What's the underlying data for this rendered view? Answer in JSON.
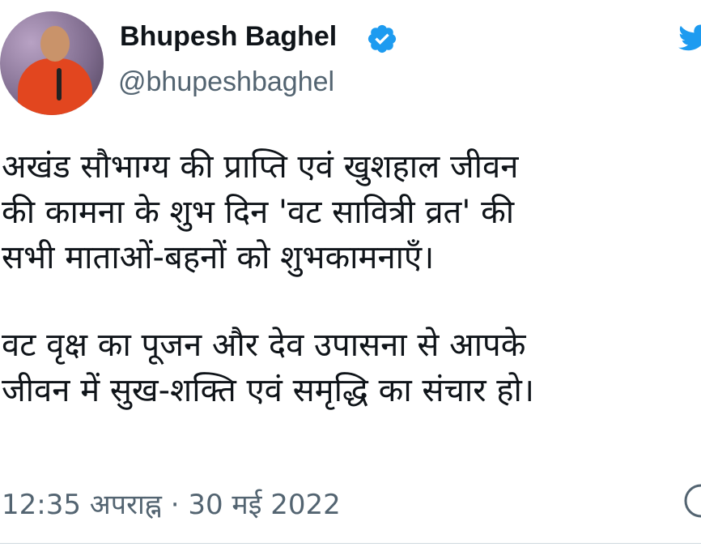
{
  "author": {
    "name": "Bhupesh Baghel",
    "handle": "@bhupeshbaghel",
    "verified": true,
    "verified_icon": "verified-badge-icon",
    "avatar": "avatar-photo"
  },
  "tweet": {
    "paragraph1": [
      "अखंड सौभाग्य की प्राप्ति एवं खुशहाल जीवन",
      "की कामना के शुभ दिन 'वट सावित्री व्रत' की",
      "सभी माताओं-बहनों को शुभकामनाएँ।"
    ],
    "paragraph2": [
      "वट वृक्ष का पूजन और देव उपासना से आपके",
      "जीवन में सुख-शक्ति एवं समृद्धि का संचार हो।"
    ],
    "timestamp": "12:35 अपराह्न · 30 मई 2022"
  },
  "icons": {
    "brand": "twitter-bird-icon",
    "info": "info-icon"
  },
  "colors": {
    "text": "#0f1419",
    "secondary": "#536471",
    "brand_blue": "#1d9bf0"
  }
}
